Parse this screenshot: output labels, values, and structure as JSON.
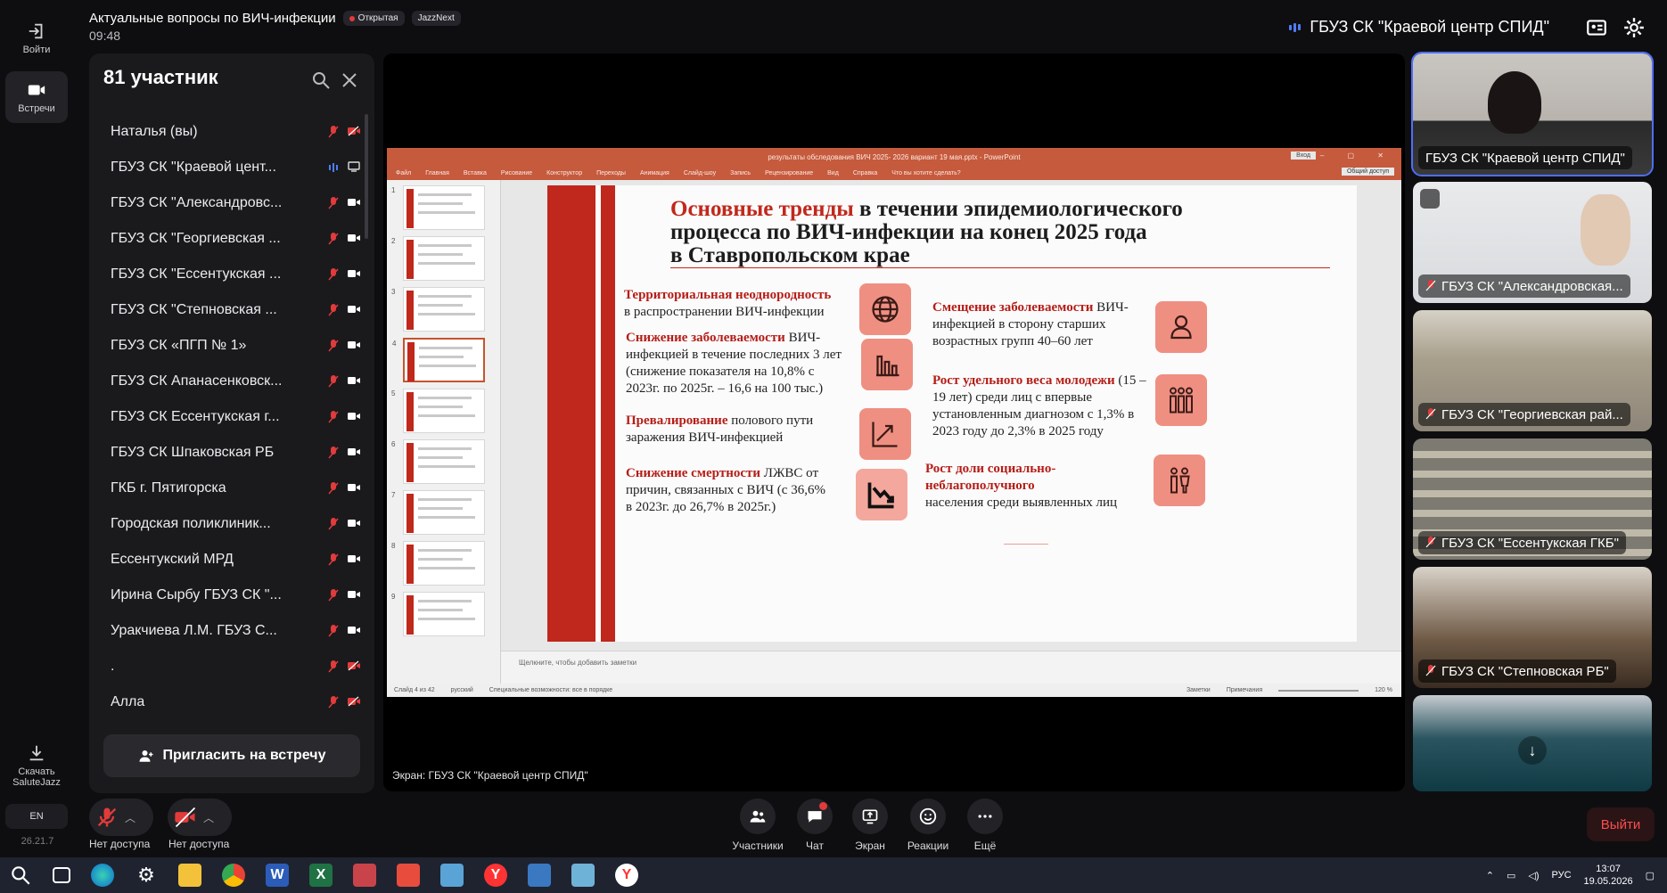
{
  "rail": {
    "login_label": "Войти",
    "meetings_label": "Встречи",
    "download_label": "Скачать SaluteJazz",
    "lang": "EN",
    "version": "26.21.7"
  },
  "header": {
    "title": "Актуальные вопросы по ВИЧ-инфекции",
    "badge_open": "Открытая",
    "badge_brand": "JazzNext",
    "time": "09:48",
    "speaker": "ГБУЗ СК \"Краевой центр СПИД\""
  },
  "participants": {
    "title": "81 участник",
    "invite_label": "Пригласить на встречу",
    "items": [
      {
        "name": "Наталья (вы)",
        "mic": "off",
        "cam": "off"
      },
      {
        "name": "ГБУЗ СК \"Краевой цент...",
        "mic": "on",
        "cam": "screen"
      },
      {
        "name": "ГБУЗ СК \"Александровс...",
        "mic": "off",
        "cam": "on"
      },
      {
        "name": "ГБУЗ СК \"Георгиевская ...",
        "mic": "off",
        "cam": "on"
      },
      {
        "name": "ГБУЗ СК \"Ессентукская ...",
        "mic": "off",
        "cam": "on"
      },
      {
        "name": "ГБУЗ СК \"Степновская ...",
        "mic": "off",
        "cam": "on"
      },
      {
        "name": "ГБУЗ СК «ПГП № 1»",
        "mic": "off",
        "cam": "on"
      },
      {
        "name": "ГБУЗ СК Апанасенковск...",
        "mic": "off",
        "cam": "on"
      },
      {
        "name": "ГБУЗ СК Ессентукская г...",
        "mic": "off",
        "cam": "on"
      },
      {
        "name": "ГБУЗ СК Шпаковская РБ",
        "mic": "off",
        "cam": "on"
      },
      {
        "name": "ГКБ г. Пятигорска",
        "mic": "off",
        "cam": "on"
      },
      {
        "name": "Городская поликлиник...",
        "mic": "off",
        "cam": "on"
      },
      {
        "name": "Ессентукский МРД",
        "mic": "off",
        "cam": "on"
      },
      {
        "name": "Ирина Сырбу ГБУЗ СК \"...",
        "mic": "off",
        "cam": "on"
      },
      {
        "name": "Уракчиева Л.М. ГБУЗ С...",
        "mic": "off",
        "cam": "on"
      },
      {
        "name": ".",
        "mic": "off",
        "cam": "off"
      },
      {
        "name": "Алла",
        "mic": "off",
        "cam": "off"
      }
    ]
  },
  "ppt": {
    "window_title": "результаты обследования ВИЧ 2025- 2026 вариант 19 мая.pptx  -  PowerPoint",
    "signin": "Вход",
    "share": "Общий доступ",
    "menu": [
      "Файл",
      "Главная",
      "Вставка",
      "Рисование",
      "Конструктор",
      "Переходы",
      "Анимация",
      "Слайд-шоу",
      "Запись",
      "Рецензирование",
      "Вид",
      "Справка",
      "Что вы хотите сделать?"
    ],
    "thumb_numbers": [
      "1",
      "2",
      "3",
      "4",
      "5",
      "6",
      "7",
      "8",
      "9"
    ],
    "notes_placeholder": "Щелкните, чтобы добавить заметки",
    "status_slide": "Слайд 4 из 42",
    "status_lang": "русский",
    "status_access": "Специальные возможности: все в порядке",
    "status_notes": "Заметки",
    "status_comments": "Примечания",
    "status_zoom": "120 %"
  },
  "slide": {
    "title_red": "Основные тренды",
    "title_rest1": " в течении эпидемиологического",
    "title_line2": "процесса по ВИЧ-инфекции  на конец 2025 года",
    "title_line3": "в Ставропольском крае",
    "left1_bold": "Территориальная неоднородность",
    "left1_text": "в  распространении ВИЧ-инфекции",
    "left2_bold": "Снижение заболеваемости",
    "left2_text": "ВИЧ-инфекцией в течение последних 3 лет (снижение показателя на 10,8% с 2023г. по 2025г. – 16,6 на 100 тыс.)",
    "left3_bold": "Превалирование",
    "left3_text": "полового пути заражения ВИЧ-инфекцией",
    "left4_bold": "Снижение смертности",
    "left4_text": "ЛЖВС от причин, связанных с ВИЧ (с 36,6% в 2023г. до 26,7% в 2025г.)",
    "right1_bold": "Смещение заболеваемости",
    "right1_text": "ВИЧ-инфекцией в сторону старших возрастных групп 40–60 лет",
    "right2_bold": "Рост удельного веса молодежи",
    "right2_text": "(15 – 19 лет) среди лиц с впервые установленным диагнозом с 1,3% в 2023 году до 2,3% в 2025 году",
    "right3_bold": "Рост доли социально-неблагополучного",
    "right3_text": "населения среди  выявленных лиц"
  },
  "screen_label": "Экран: ГБУЗ СК \"Краевой центр СПИД\"",
  "tiles": [
    {
      "name": "ГБУЗ СК \"Краевой центр СПИД\""
    },
    {
      "name": "ГБУЗ СК \"Александровская..."
    },
    {
      "name": "ГБУЗ СК \"Георгиевская рай..."
    },
    {
      "name": "ГБУЗ СК \"Ессентукская ГКБ\""
    },
    {
      "name": "ГБУЗ СК \"Степновская РБ\""
    }
  ],
  "controls": {
    "mic_label": "Нет доступа",
    "cam_label": "Нет доступа",
    "participants": "Участники",
    "chat": "Чат",
    "screen": "Экран",
    "reactions": "Реакции",
    "more": "Ещё",
    "leave": "Выйти"
  },
  "taskbar": {
    "lang": "РУС",
    "time": "13:07",
    "date": "19.05.2026"
  },
  "colors": {
    "accent": "#4f6ef7",
    "danger": "#e23b3b",
    "ppt_brand": "#c55a3d",
    "slide_red": "#c1281c",
    "icon_bg": "#ef8f82"
  }
}
